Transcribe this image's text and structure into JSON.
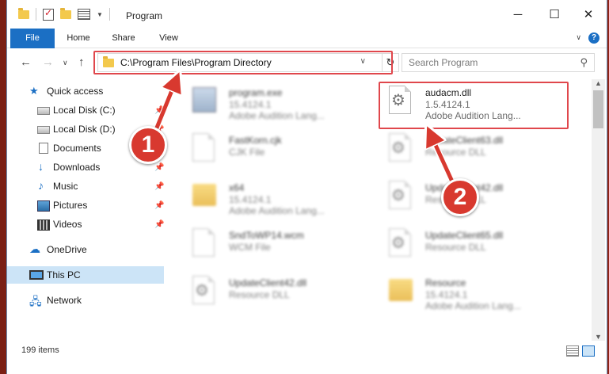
{
  "window": {
    "title": "Program"
  },
  "ribbon": {
    "tabs": [
      "File",
      "Home",
      "Share",
      "View"
    ],
    "help": "?"
  },
  "address": {
    "path": "C:\\Program Files\\Program Directory"
  },
  "search": {
    "placeholder": "Search Program"
  },
  "sidebar": {
    "items": [
      {
        "label": "Quick access",
        "icon": "star-icon"
      },
      {
        "label": "Local Disk (C:)",
        "icon": "disk-icon"
      },
      {
        "label": "Local Disk (D:)",
        "icon": "disk-icon"
      },
      {
        "label": "Documents",
        "icon": "document-icon"
      },
      {
        "label": "Downloads",
        "icon": "download-icon"
      },
      {
        "label": "Music",
        "icon": "music-icon"
      },
      {
        "label": "Pictures",
        "icon": "pictures-icon"
      },
      {
        "label": "Videos",
        "icon": "videos-icon"
      },
      {
        "label": "OneDrive",
        "icon": "cloud-icon"
      },
      {
        "label": "This PC",
        "icon": "computer-icon"
      },
      {
        "label": "Network",
        "icon": "network-icon"
      }
    ]
  },
  "files": [
    {
      "name": "program.exe",
      "meta1": "15.4124.1",
      "meta2": "Adobe Audition Lang...",
      "icon": "exe-icon"
    },
    {
      "name": "audacm.dll",
      "meta1": "1.5.4124.1",
      "meta2": "Adobe Audition Lang...",
      "icon": "dll-gear-icon"
    },
    {
      "name": "FastKorn.cjk",
      "meta1": "CJK File",
      "meta2": "",
      "icon": "file-icon"
    },
    {
      "name": "UpdateClient63.dll",
      "meta1": "Resource DLL",
      "meta2": "",
      "icon": "dll-gear-icon"
    },
    {
      "name": "x64",
      "meta1": "15.4124.1",
      "meta2": "Adobe Audition Lang...",
      "icon": "folder-icon"
    },
    {
      "name": "UpdateClient42.dll",
      "meta1": "Resource DLL",
      "meta2": "",
      "icon": "dll-gear-icon"
    },
    {
      "name": "SndToWP14.wcm",
      "meta1": "WCM File",
      "meta2": "",
      "icon": "file-icon"
    },
    {
      "name": "UpdateClient65.dll",
      "meta1": "Resource DLL",
      "meta2": "",
      "icon": "dll-gear-icon"
    },
    {
      "name": "UpdateClient42.dll",
      "meta1": "Resource DLL",
      "meta2": "",
      "icon": "dll-gear-icon"
    },
    {
      "name": "Resource",
      "meta1": "15.4124.1",
      "meta2": "Adobe Audition Lang...",
      "icon": "folder-icon"
    }
  ],
  "status": {
    "count": "199 items"
  },
  "annotations": {
    "step1": "1",
    "step2": "2",
    "color": "#d8392f"
  }
}
